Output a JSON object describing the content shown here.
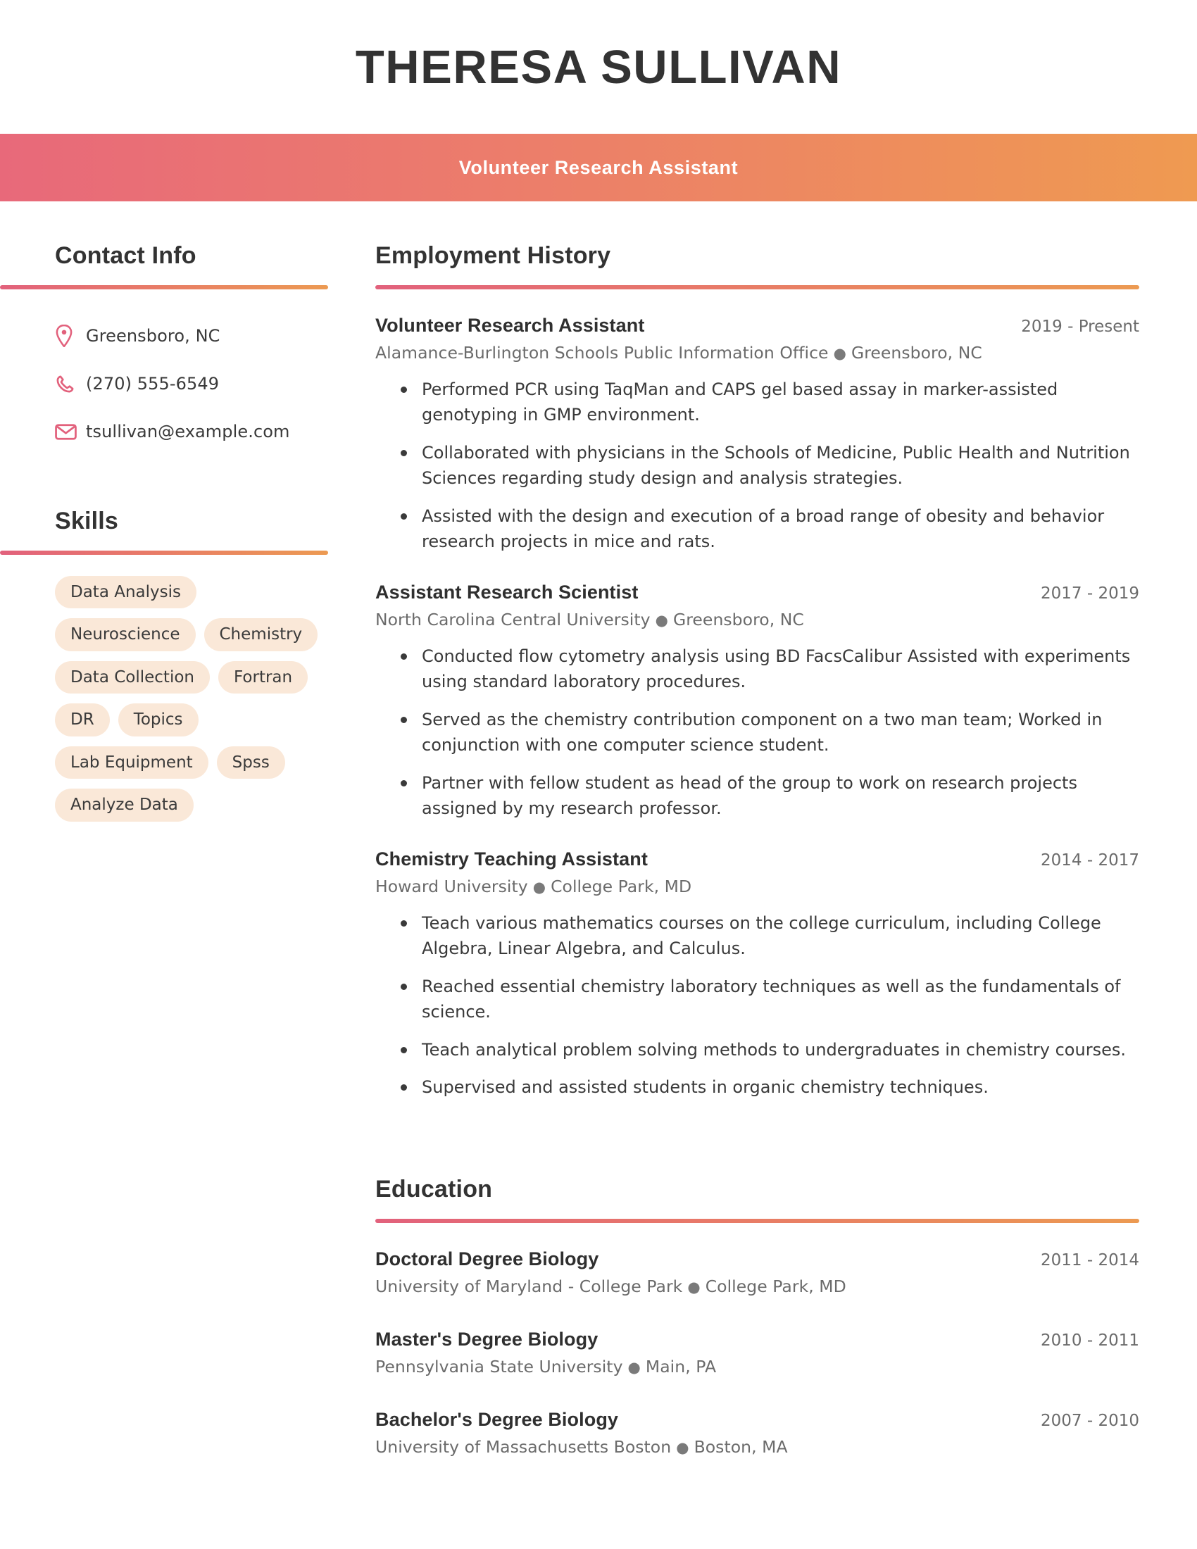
{
  "header": {
    "full_name": "THERESA SULLIVAN",
    "job_title": "Volunteer Research Assistant",
    "accent_start": "#E8697A",
    "accent_end": "#EF9A51"
  },
  "sidebar": {
    "contact": {
      "heading": "Contact Info",
      "items": [
        {
          "icon": "location-pin-icon",
          "value": "Greensboro, NC"
        },
        {
          "icon": "phone-icon",
          "value": "(270) 555-6549"
        },
        {
          "icon": "envelope-icon",
          "value": "tsullivan@example.com"
        }
      ]
    },
    "skills": {
      "heading": "Skills",
      "pill_color": "#FAE8D8",
      "items": [
        "Data Analysis",
        "Neuroscience",
        "Chemistry",
        "Data Collection",
        "Fortran",
        "DR",
        "Topics",
        "Lab Equipment",
        "Spss",
        "Analyze Data"
      ]
    }
  },
  "main": {
    "employment": {
      "heading": "Employment History",
      "entries": [
        {
          "title": "Volunteer Research Assistant",
          "dates": "2019 - Present",
          "company": "Alamance-Burlington Schools Public Information Office",
          "location": "Greensboro, NC",
          "bullets": [
            "Performed PCR using TaqMan and CAPS gel based assay in marker-assisted genotyping in GMP environment.",
            "Collaborated with physicians in the Schools of Medicine, Public Health and Nutrition Sciences regarding study design and analysis strategies.",
            "Assisted with the design and execution of a broad range of obesity and behavior research projects in mice and rats."
          ]
        },
        {
          "title": "Assistant Research Scientist",
          "dates": "2017 - 2019",
          "company": "North Carolina Central University",
          "location": "Greensboro, NC",
          "bullets": [
            "Conducted flow cytometry analysis using BD FacsCalibur Assisted with experiments using standard laboratory procedures.",
            "Served as the chemistry contribution component on a two man team; Worked in conjunction with one computer science student.",
            "Partner with fellow student as head of the group to work on research projects assigned by my research professor."
          ]
        },
        {
          "title": "Chemistry Teaching Assistant",
          "dates": "2014 - 2017",
          "company": "Howard University",
          "location": "College Park, MD",
          "bullets": [
            "Teach various mathematics courses on the college curriculum, including College Algebra, Linear Algebra, and Calculus.",
            "Reached essential chemistry laboratory techniques as well as the fundamentals of science.",
            "Teach analytical problem solving methods to undergraduates in chemistry courses.",
            "Supervised and assisted students in organic chemistry techniques."
          ]
        }
      ]
    },
    "education": {
      "heading": "Education",
      "entries": [
        {
          "degree": "Doctoral Degree Biology",
          "dates": "2011 - 2014",
          "school": "University of Maryland - College Park",
          "location": "College Park, MD"
        },
        {
          "degree": "Master's Degree Biology",
          "dates": "2010 - 2011",
          "school": "Pennsylvania State University",
          "location": "Main, PA"
        },
        {
          "degree": "Bachelor's Degree Biology",
          "dates": "2007 - 2010",
          "school": "University of Massachusetts Boston",
          "location": "Boston, MA"
        }
      ]
    }
  }
}
